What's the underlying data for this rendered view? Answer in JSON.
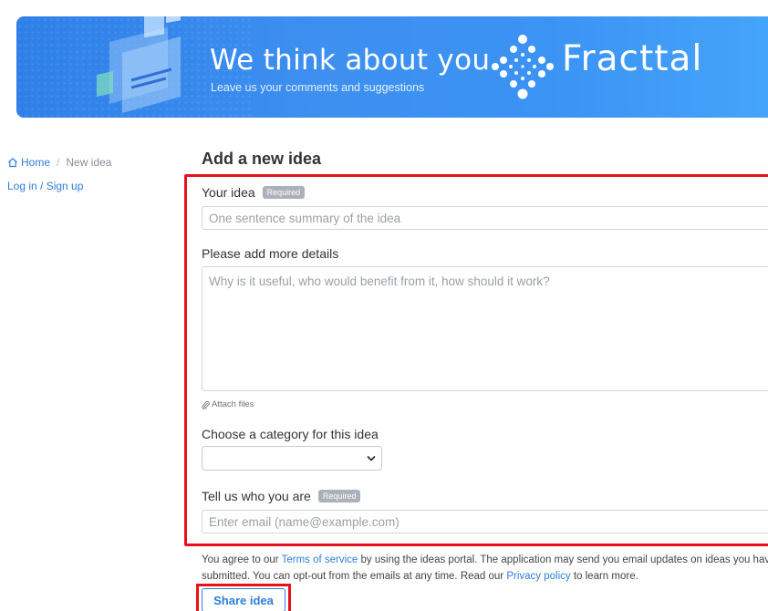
{
  "banner": {
    "title": "We think about you",
    "subtitle": "Leave us your comments and suggestions",
    "brand_name": "Fracttal",
    "logo_icon": "dotted-diamond-logo-icon",
    "background_color": "#3b8ff0"
  },
  "sidebar": {
    "breadcrumb_home": "Home",
    "breadcrumb_home_icon": "home-icon",
    "breadcrumb_separator": "/",
    "breadcrumb_current": "New idea",
    "login_label": "Log in / Sign up"
  },
  "form": {
    "page_title": "Add a new idea",
    "idea_label": "Your idea",
    "required_badge": "Required",
    "idea_placeholder": "One sentence summary of the idea",
    "details_label": "Please add more details",
    "details_placeholder": "Why is it useful, who would benefit from it, how should it work?",
    "attach_label": "Attach files",
    "attach_icon": "paperclip-icon",
    "category_label": "Choose a category for this idea",
    "category_selected": "",
    "who_label": "Tell us who you are",
    "email_placeholder": "Enter email (name@example.com)"
  },
  "footer": {
    "agree_prefix": "You agree to our ",
    "terms_link": "Terms of service",
    "agree_middle": " by using the ideas portal. The application may send you email updates on ideas you have submitted. You can opt-out from the emails at any time. Read our ",
    "privacy_link": "Privacy policy",
    "agree_suffix": " to learn more.",
    "share_button": "Share idea"
  },
  "colors": {
    "accent": "#2d7ed8",
    "highlight_frame": "#e8101a",
    "badge": "#aab1b8"
  }
}
